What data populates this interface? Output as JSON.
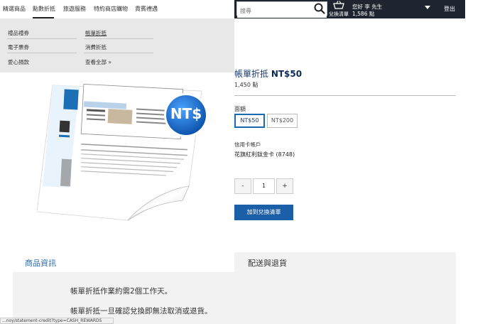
{
  "nav": {
    "items": [
      "精選商品",
      "點數折抵",
      "旅遊服務",
      "特約商店購物",
      "貴賓禮遇"
    ]
  },
  "header": {
    "search_placeholder": "搜尋",
    "redeem_cart_label": "兌換清單",
    "greeting": "您好 李 先生",
    "points": "1,586 點",
    "logout_label": "登出"
  },
  "dropdown": {
    "left": [
      "禮品禮券",
      "電子票券",
      "愛心捐款"
    ],
    "right": [
      "帳單折抵",
      "消費折抵",
      "查看全部 »"
    ]
  },
  "product": {
    "title_prefix": "帳單折抵 ",
    "title_amount": "NT$50",
    "points": "1,450 點",
    "badge_text": "NT$",
    "denomination_label": "面額",
    "denominations": [
      "NT$50",
      "NT$200"
    ],
    "selected_denomination": "NT$50",
    "card_label": "信用卡帳戶",
    "card_value": "花旗紅利鈦金卡 (8748)",
    "quantity": "1",
    "minus_label": "-",
    "plus_label": "+",
    "add_button_label": "加到兌換清單"
  },
  "tabs": {
    "info_label": "商品資訊",
    "shipping_label": "配送與退貨"
  },
  "info_lines": [
    "帳單折抵作業約需2個工作天。",
    "帳單折抵一旦確認兌換即無法取消或退貨。"
  ],
  "status_bar": "...noy/statement-credit?type=CASH_REWARDS",
  "colors": {
    "header_dark": "#1e2530",
    "accent_blue": "#1a5fa8",
    "badge_blue": "#1a6fd0"
  }
}
